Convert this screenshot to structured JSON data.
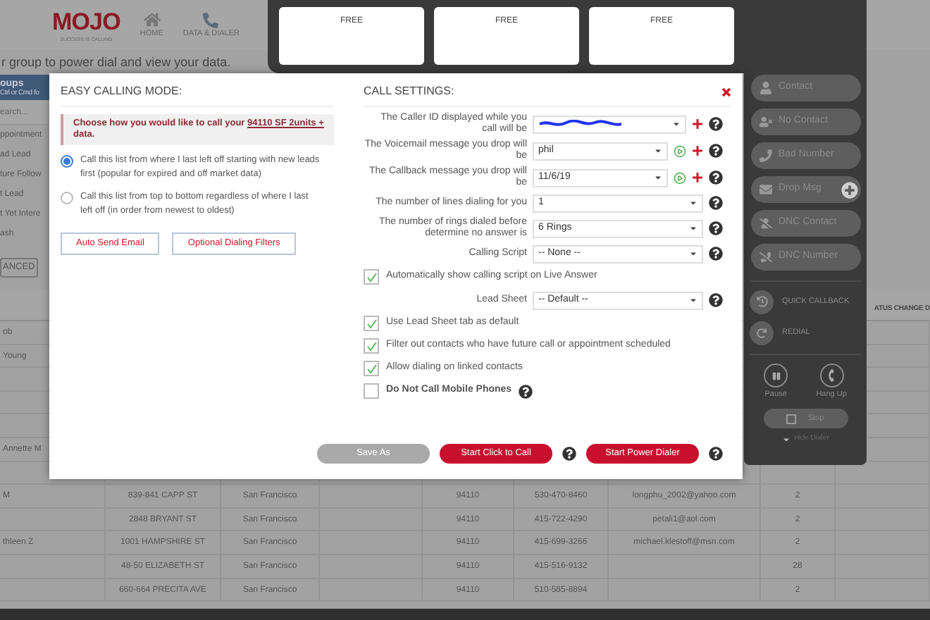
{
  "header": {
    "logo": "MOJO",
    "tagline": "SUCCESS IS CALLING",
    "nav": [
      {
        "label": "HOME",
        "kind": "home"
      },
      {
        "label": "DATA & DIALER",
        "kind": "dialer"
      }
    ]
  },
  "subtitle": "r group to power dial and view your data.",
  "sidebar": {
    "title": "oups",
    "hint": "Ctrl or Cmd fo",
    "search_placeholder": "earch...",
    "items": [
      "ppointment",
      "ad Lead",
      "ture Follow",
      "t Lead",
      "t Yet Intere",
      "ash"
    ],
    "button": "ANCED"
  },
  "table": {
    "visible_column_heading": "ATUS CHANGE D",
    "rows": [
      {
        "name": "ob"
      },
      {
        "name": "Young"
      },
      {},
      {},
      {},
      {
        "name": "Annette M"
      },
      {},
      {
        "name": "M",
        "address": "839-841 CAPP ST",
        "city": "San Francisco",
        "zip": "94110",
        "phone": "530-470-8460",
        "email": "longphu_2002@yahoo.com",
        "column_8": "2"
      },
      {
        "address": "2848 BRYANT ST",
        "city": "San Francisco",
        "zip": "94110",
        "phone": "415-722-4290",
        "email": "petali1@aol.com",
        "column_8": "2"
      },
      {
        "name": "thleen Z",
        "address": "1001 HAMPSHIRE ST",
        "city": "San Francisco",
        "zip": "94110",
        "phone": "415-699-3266",
        "email": "michael.klestoff@msn.com",
        "column_8": "2"
      },
      {
        "address": "48-50 ELIZABETH ST",
        "city": "San Francisco",
        "zip": "94110",
        "phone": "415-516-9132",
        "column_8": "28"
      },
      {
        "address": "660-664 PRECITA AVE",
        "city": "San Francisco",
        "zip": "94110",
        "phone": "510-585-8894",
        "column_8": "2"
      }
    ]
  },
  "dialer": {
    "lines": [
      {
        "label": "FREE"
      },
      {
        "label": "FREE"
      },
      {
        "label": "FREE"
      }
    ],
    "outcomes": [
      {
        "label": "Contact",
        "kind": "contact",
        "add": false
      },
      {
        "label": "No Contact",
        "kind": "nocontact",
        "add": false
      },
      {
        "label": "Bad Number",
        "kind": "bad",
        "add": false
      },
      {
        "label": "Drop Msg",
        "kind": "message",
        "add": true
      },
      {
        "label": "DNC Contact",
        "kind": "dnccontact",
        "add": false
      },
      {
        "label": "DNC Number",
        "kind": "dncnumber",
        "add": false
      }
    ],
    "quick": [
      {
        "label": "QUICK CALLBACK",
        "kind": "callback"
      },
      {
        "label": "REDIAL",
        "kind": "redial"
      }
    ],
    "controls": [
      {
        "label": "Pause",
        "kind": "pause"
      },
      {
        "label": "Hang Up",
        "kind": "hangup"
      }
    ],
    "stop": "Stop",
    "hide": "Hide Dialer"
  },
  "modal": {
    "left_title": "EASY CALLING MODE:",
    "prompt": {
      "before": "Choose how you would like to call your ",
      "link": "94110 SF 2units +",
      "after": " data."
    },
    "modes": [
      {
        "label": "Call this list from where I last left off starting with new leads first (popular for expired and off market data)",
        "selected": true
      },
      {
        "label": "Call this list from top to bottom regardless of where I last left off (in order from newest to oldest)",
        "selected": false
      }
    ],
    "buttons": [
      "Auto Send Email",
      "Optional Dialing Filters"
    ],
    "right_title": "CALL SETTINGS:",
    "settings": [
      {
        "kind": "select",
        "label": "The Caller ID displayed while you call will be",
        "redacted": true,
        "play": false,
        "add": true,
        "help": true
      },
      {
        "kind": "select",
        "label": "The Voicemail message you drop will be",
        "value": "phil",
        "redacted": false,
        "play": true,
        "add": true,
        "help": true
      },
      {
        "kind": "select",
        "label": "The Callback message you drop will be",
        "value": "11/6/19",
        "redacted": false,
        "play": true,
        "add": true,
        "help": true
      },
      {
        "kind": "select",
        "label": "The number of lines dialing for you",
        "value": "1",
        "redacted": false,
        "play": false,
        "add": false,
        "help": true
      },
      {
        "kind": "select",
        "label": "The number of rings dialed before determine no answer is",
        "value": "6 Rings",
        "redacted": false,
        "play": false,
        "add": false,
        "help": true
      },
      {
        "kind": "select",
        "label": "Calling Script",
        "value": "-- None --",
        "redacted": false,
        "play": false,
        "add": false,
        "help": true
      },
      {
        "kind": "checkbox",
        "label": "Automatically show calling script on Live Answer",
        "checked": true,
        "bold": false,
        "help": false
      },
      {
        "kind": "select",
        "label": "Lead Sheet",
        "value": "-- Default --",
        "redacted": false,
        "play": false,
        "add": false,
        "help": true
      },
      {
        "kind": "checkbox",
        "label": "Use Lead Sheet tab as default",
        "checked": true,
        "bold": false,
        "help": false
      },
      {
        "kind": "checkbox",
        "label": "Filter out contacts who have future call or appointment scheduled",
        "checked": true,
        "bold": false,
        "help": false
      },
      {
        "kind": "checkbox",
        "label": "Allow dialing on linked contacts",
        "checked": true,
        "bold": false,
        "help": false
      },
      {
        "kind": "checkbox",
        "label": "Do Not Call Mobile Phones",
        "checked": false,
        "bold": true,
        "help": true
      }
    ],
    "footer": [
      {
        "label": "Save As",
        "kind": "secondary",
        "help": false
      },
      {
        "label": "Start Click to Call",
        "kind": "primary",
        "help": true
      },
      {
        "label": "Start Power Dialer",
        "kind": "primary",
        "help": true
      }
    ]
  }
}
